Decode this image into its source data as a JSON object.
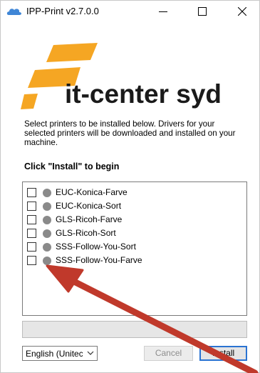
{
  "window": {
    "title": "IPP-Print v2.7.0.0"
  },
  "logo": {
    "text": "it-center syd",
    "brand_color": "#f5a623"
  },
  "intro_text": "Select printers to be installed below. Drivers for your selected printers will be downloaded and installed on your machine.",
  "heading": "Click \"Install\" to begin",
  "printers": [
    {
      "label": "EUC-Konica-Farve",
      "checked": false
    },
    {
      "label": "EUC-Konica-Sort",
      "checked": false
    },
    {
      "label": "GLS-Ricoh-Farve",
      "checked": false
    },
    {
      "label": "GLS-Ricoh-Sort",
      "checked": false
    },
    {
      "label": "SSS-Follow-You-Sort",
      "checked": false
    },
    {
      "label": "SSS-Follow-You-Farve",
      "checked": false
    }
  ],
  "progress": {
    "value": 0
  },
  "footer": {
    "language": "English (Unitec",
    "cancel_label": "Cancel",
    "install_label": "Install"
  },
  "annotation": {
    "arrow_color": "#c0392b"
  }
}
